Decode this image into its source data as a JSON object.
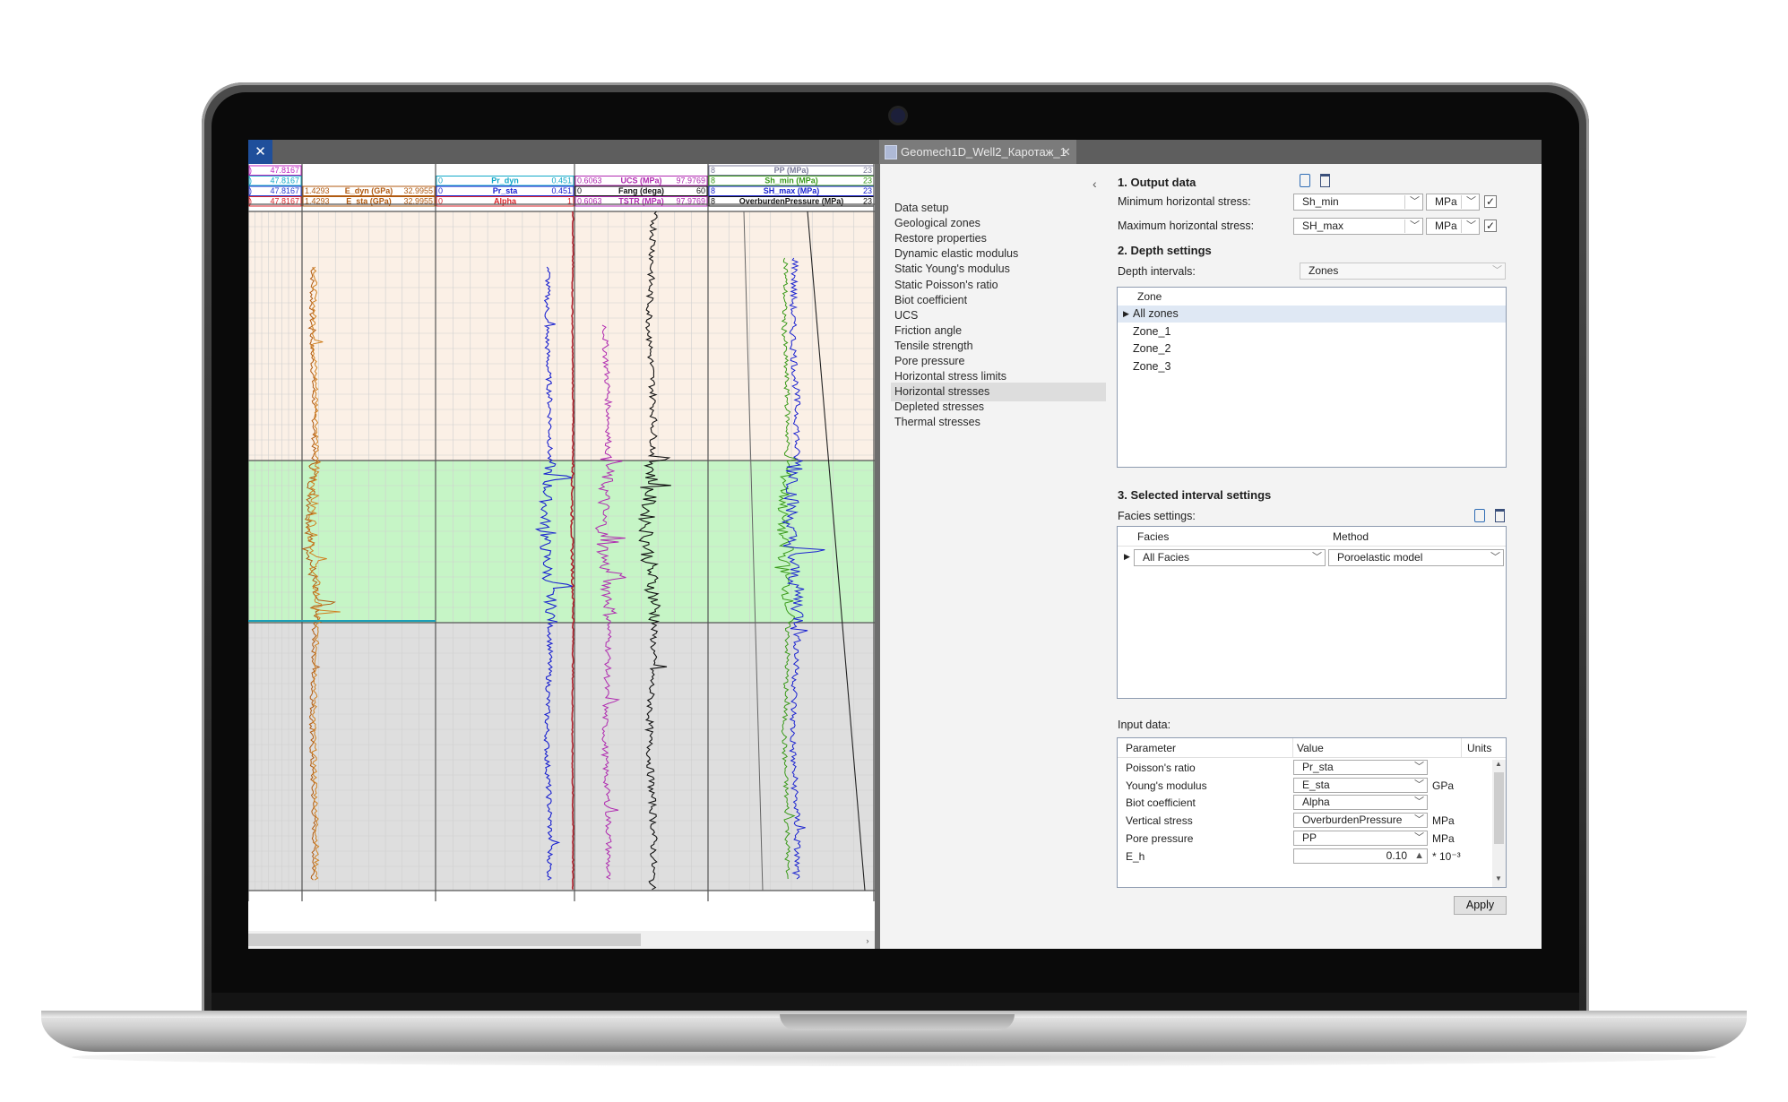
{
  "window": {
    "close_glyph": "✕",
    "tab_title": "Geomech1D_Well2_Каротаж_1",
    "tab_close_glyph": "✕"
  },
  "log_header": {
    "track1": [
      {
        "left": ")",
        "value": "47.8167",
        "color": "#c026c0"
      },
      {
        "left": ")",
        "value": "47.8167",
        "color": "#12a8c8"
      },
      {
        "left": ")",
        "value": "47.8167",
        "color": "#2a3bd0"
      },
      {
        "left": ")",
        "value": "47.8167",
        "color": "#d8262b"
      }
    ],
    "track2": [
      {
        "min": "1.4293",
        "name": "E_dyn (GPa)",
        "max": "32.9955",
        "color": "#b05a10"
      },
      {
        "min": "1.4293",
        "name": "E_sta (GPa)",
        "max": "32.9955",
        "color": "#b05a10"
      }
    ],
    "track3": [
      {
        "min": "0",
        "name": "Pr_dyn",
        "max": "0.451",
        "color": "#12a8c8"
      },
      {
        "min": "0",
        "name": "Pr_sta",
        "max": "0.451",
        "color": "#1a22d0"
      },
      {
        "min": "0",
        "name": "Alpha",
        "max": "1",
        "color": "#d8262b"
      }
    ],
    "track4": [
      {
        "min": "0.6063",
        "name": "UCS (MPa)",
        "max": "97.9769",
        "color": "#b02ab0"
      },
      {
        "min": "0",
        "name": "Fang (dega)",
        "max": "60",
        "color": "#111111"
      },
      {
        "min": "0.6063",
        "name": "TSTR (MPa)",
        "max": "97.9769",
        "color": "#b02ab0"
      }
    ],
    "track5": [
      {
        "min": "8",
        "name": "PP (MPa)",
        "max": "23",
        "color": "#7a7a9a"
      },
      {
        "min": "8",
        "name": "Sh_min (MPa)",
        "max": "23",
        "color": "#3a9a1a"
      },
      {
        "min": "8",
        "name": "SH_max (MPa)",
        "max": "23",
        "color": "#1a22d0"
      },
      {
        "min": "8",
        "name": "OverburdenPressure (MPa)",
        "max": "23",
        "color": "#111111"
      }
    ]
  },
  "colors": {
    "zone_upper": "#fbf0e6",
    "zone_middle": "#c6f5c6",
    "zone_lower": "#dedede",
    "accent": "#1f4f9b"
  },
  "nav": {
    "collapse_glyph": "‹",
    "items": [
      "Data setup",
      "Geological zones",
      "Restore properties",
      "Dynamic elastic modulus",
      "Static Young's modulus",
      "Static Poisson's ratio",
      "Biot coefficient",
      "UCS",
      "Friction angle",
      "Tensile strength",
      "Pore pressure",
      "Horizontal stress limits",
      "Horizontal stresses",
      "Depleted stresses",
      "Thermal stresses"
    ],
    "active_index": 12
  },
  "output": {
    "title": "1. Output data",
    "min_label": "Minimum horizontal stress:",
    "min_value": "Sh_min",
    "min_unit": "MPa",
    "max_label": "Maximum horizontal stress:",
    "max_value": "SH_max",
    "max_unit": "MPa",
    "check_glyph": "✓"
  },
  "depth": {
    "title": "2. Depth settings",
    "intervals_label": "Depth intervals:",
    "intervals_value": "Zones",
    "zone_header": "Zone",
    "zones": [
      "All zones",
      "Zone_1",
      "Zone_2",
      "Zone_3"
    ]
  },
  "interval": {
    "title": "3. Selected interval settings",
    "facies_label": "Facies settings:",
    "facies_header": "Facies",
    "method_header": "Method",
    "facies_value": "All Facies",
    "method_value": "Poroelastic model"
  },
  "input": {
    "label": "Input data:",
    "headers": {
      "parameter": "Parameter",
      "value": "Value",
      "units": "Units"
    },
    "rows": [
      {
        "parameter": "Poisson's ratio",
        "value": "Pr_sta",
        "units": ""
      },
      {
        "parameter": "Young's modulus",
        "value": "E_sta",
        "units": "GPa"
      },
      {
        "parameter": "Biot coefficient",
        "value": "Alpha",
        "units": ""
      },
      {
        "parameter": "Vertical stress",
        "value": "OverburdenPressure",
        "units": "MPa"
      },
      {
        "parameter": "Pore pressure",
        "value": "PP",
        "units": "MPa"
      },
      {
        "parameter": "E_h",
        "value": "0.10",
        "units": "* 10⁻³"
      }
    ],
    "scroll_up": "▲",
    "scroll_down": "▼"
  },
  "apply_label": "Apply",
  "row_marker": "▶",
  "dropdown_arrow": "﹀"
}
